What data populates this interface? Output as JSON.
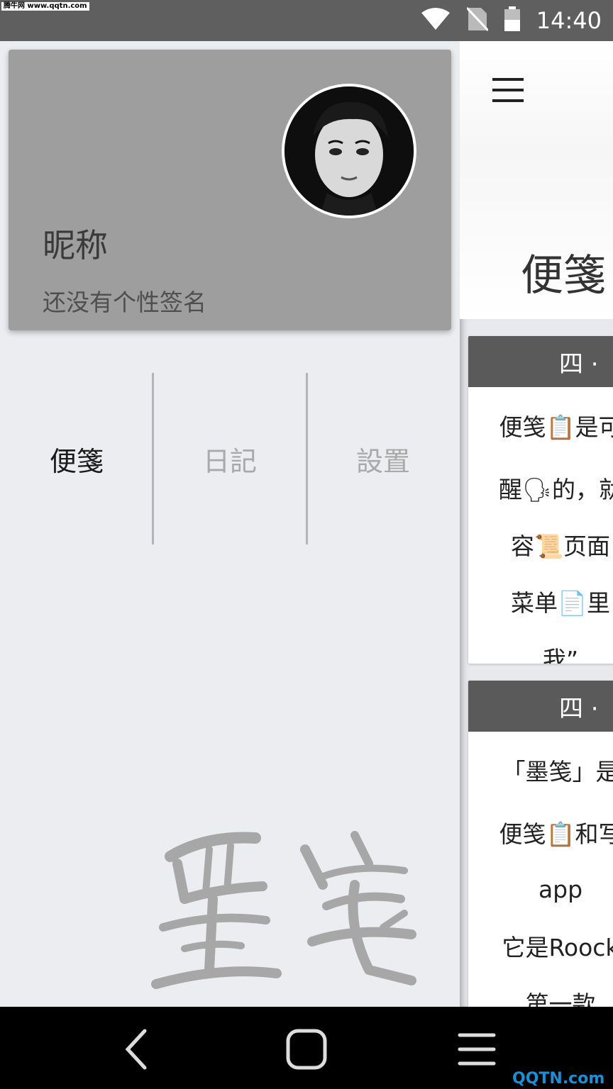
{
  "status_bar": {
    "watermark": "腾牛网 www.qqtn.com",
    "time": "14:40",
    "icons": [
      "wifi-icon",
      "no-sim-icon",
      "battery-icon"
    ]
  },
  "drawer": {
    "profile": {
      "nickname": "昵称",
      "signature": "还没有个性签名"
    },
    "tabs": [
      {
        "label": "便箋",
        "active": true
      },
      {
        "label": "日記",
        "active": false
      },
      {
        "label": "設置",
        "active": false
      }
    ],
    "logo_text": "墨笺"
  },
  "main": {
    "title": "便箋",
    "cards": [
      {
        "header": "四 · ",
        "lines": [
          "便笺📋是可",
          "醒🗣的，就",
          "容📜页面",
          "菜单📄里",
          "我”"
        ]
      },
      {
        "header": "四 · ",
        "lines": [
          "「墨笺」是",
          "便笺📋和写",
          "app",
          "它是Roock",
          "第一款"
        ]
      }
    ]
  },
  "nav_bar": {
    "icons": [
      "back-icon",
      "home-icon",
      "menu-icon"
    ]
  },
  "corner_logo": "QQTN.com",
  "colors": {
    "status_bar": "#5f5f5f",
    "profile_card": "#9e9e9e",
    "drawer_bg": "#ebedf0",
    "card_header": "#5a5a5a",
    "nav_bar": "#000000"
  }
}
